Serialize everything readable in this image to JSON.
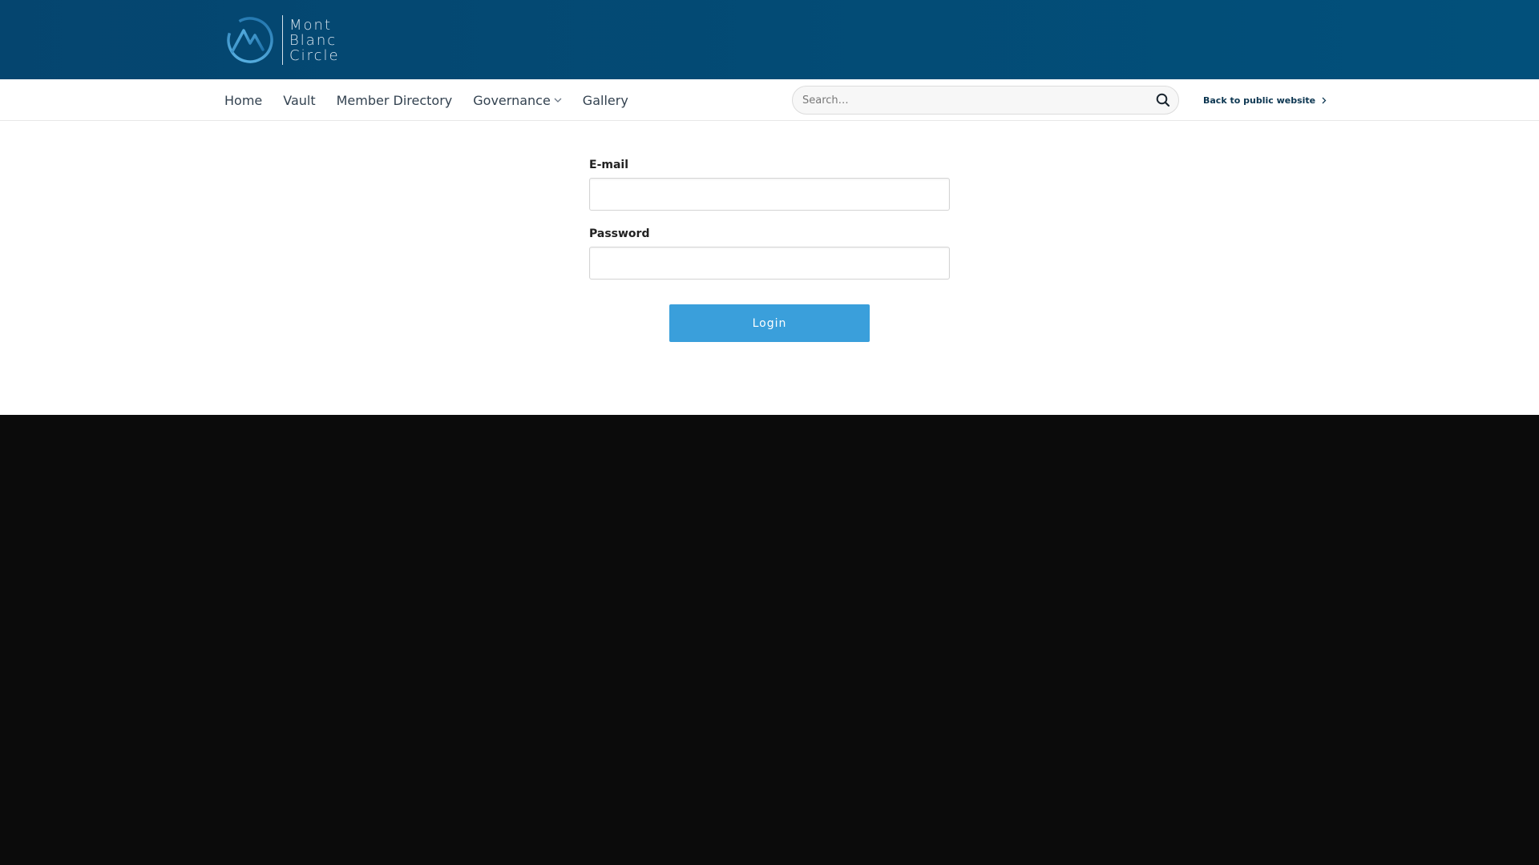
{
  "brand": {
    "logo_lines": [
      "Mont",
      "Blanc",
      "Circle"
    ],
    "colors": {
      "header_bg": "#034b75",
      "logo_blue": "#2a8ccc",
      "accent": "#3a9fdb",
      "footer_bg": "#0b0b0b"
    }
  },
  "nav": {
    "items": [
      {
        "label": "Home"
      },
      {
        "label": "Vault"
      },
      {
        "label": "Member Directory"
      },
      {
        "label": "Governance",
        "icon": "chevron-down-icon"
      },
      {
        "label": "Gallery"
      }
    ],
    "search": {
      "placeholder": "Search…",
      "value": "",
      "icon": "search-icon"
    },
    "back_link": {
      "label": "Back to public website",
      "icon": "chevron-right-icon"
    }
  },
  "login": {
    "email_label": "E-mail",
    "email_value": "",
    "password_label": "Password",
    "password_value": "",
    "submit_label": "Login"
  }
}
